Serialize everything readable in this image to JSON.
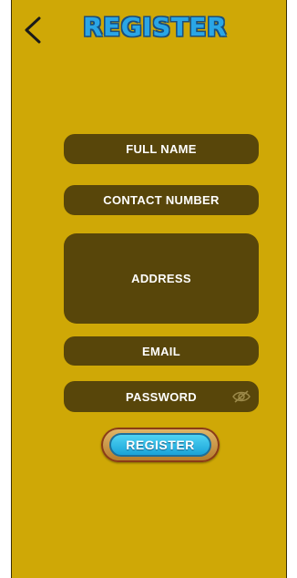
{
  "header": {
    "title": "REGISTER",
    "back_icon": "chevron-left-icon"
  },
  "form": {
    "full_name_placeholder": "FULL NAME",
    "contact_placeholder": "CONTACT NUMBER",
    "address_placeholder": "ADDRESS",
    "email_placeholder": "EMAIL",
    "password_placeholder": "PASSWORD",
    "password_visibility_icon": "eye-off-icon"
  },
  "actions": {
    "register_label": "REGISTER"
  },
  "colors": {
    "background": "#cfa806",
    "field": "#58460a",
    "title": "#2aa6e6",
    "button": "#1aa3d8",
    "button_frame": "#b47a2a"
  }
}
